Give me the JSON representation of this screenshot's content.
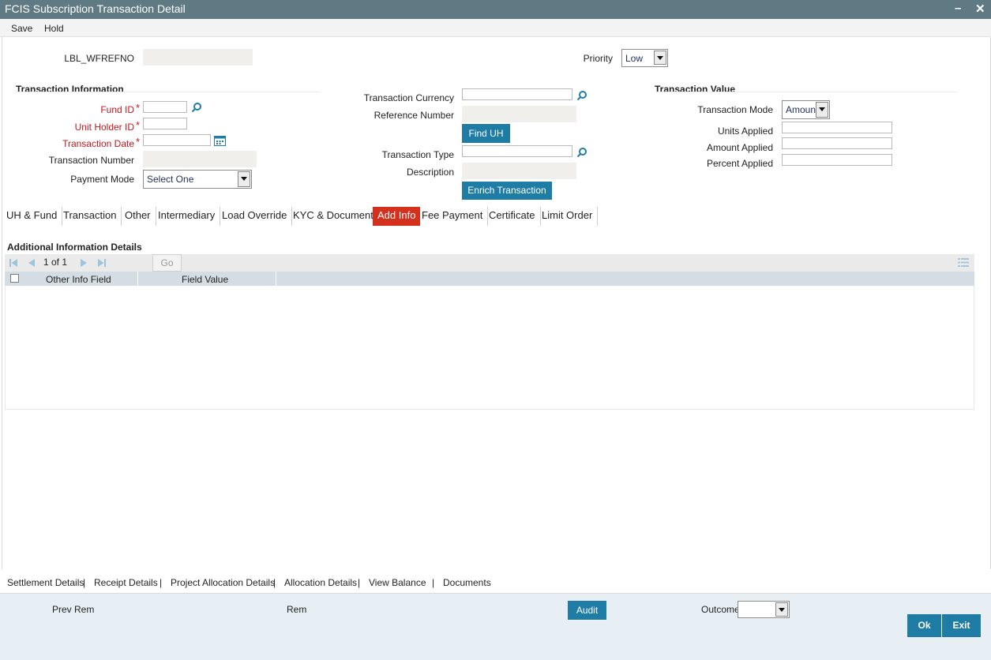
{
  "window": {
    "title": "FCIS Subscription Transaction Detail",
    "minimize": "–",
    "close": "✕"
  },
  "menu": {
    "save": "Save",
    "hold": "Hold"
  },
  "header": {
    "wfref_label": "LBL_WFREFNO",
    "priority_label": "Priority",
    "priority_value": "Low"
  },
  "txn_info": {
    "section": "Transaction Information",
    "fund_id": "Fund ID",
    "unit_holder_id": "Unit Holder ID",
    "transaction_date": "Transaction Date",
    "transaction_number": "Transaction Number",
    "payment_mode": "Payment Mode",
    "payment_mode_value": "Select One",
    "required_mark": "*"
  },
  "middle": {
    "transaction_currency": "Transaction Currency",
    "reference_number": "Reference Number",
    "find_uh": "Find UH",
    "transaction_type": "Transaction Type",
    "description": "Description",
    "enrich": "Enrich Transaction"
  },
  "txn_value": {
    "section": "Transaction Value",
    "transaction_mode": "Transaction Mode",
    "transaction_mode_value": "Amount",
    "units_applied": "Units Applied",
    "amount_applied": "Amount Applied",
    "percent_applied": "Percent Applied"
  },
  "tabs": [
    "UH & Fund",
    "Transaction",
    "Other",
    "Intermediary",
    "Load Override",
    "KYC & Document",
    "Add Info",
    "Fee Payment",
    "Certificate",
    "Limit Order"
  ],
  "active_tab": "Add Info",
  "additional_info": {
    "section": "Additional Information Details",
    "page_text": "1 of 1",
    "go": "Go",
    "columns": [
      "Other Info Field",
      "Field Value"
    ]
  },
  "bottom_links": [
    "Settlement Details",
    "Receipt Details",
    "Project Allocation Details",
    "Allocation Details",
    "View Balance",
    "Documents"
  ],
  "link_separator": "|",
  "footer": {
    "prev_rem": "Prev Rem",
    "rem": "Rem",
    "audit": "Audit",
    "outcome": "Outcome",
    "ok": "Ok",
    "exit": "Exit"
  },
  "colors": {
    "titlebar": "#5f7a83",
    "button": "#1f7ca5",
    "active_tab": "#d3311d",
    "required": "#c0181f"
  },
  "icons": [
    "search-icon",
    "calendar-icon",
    "first-page-icon",
    "prev-page-icon",
    "next-page-icon",
    "last-page-icon",
    "column-settings-icon"
  ]
}
